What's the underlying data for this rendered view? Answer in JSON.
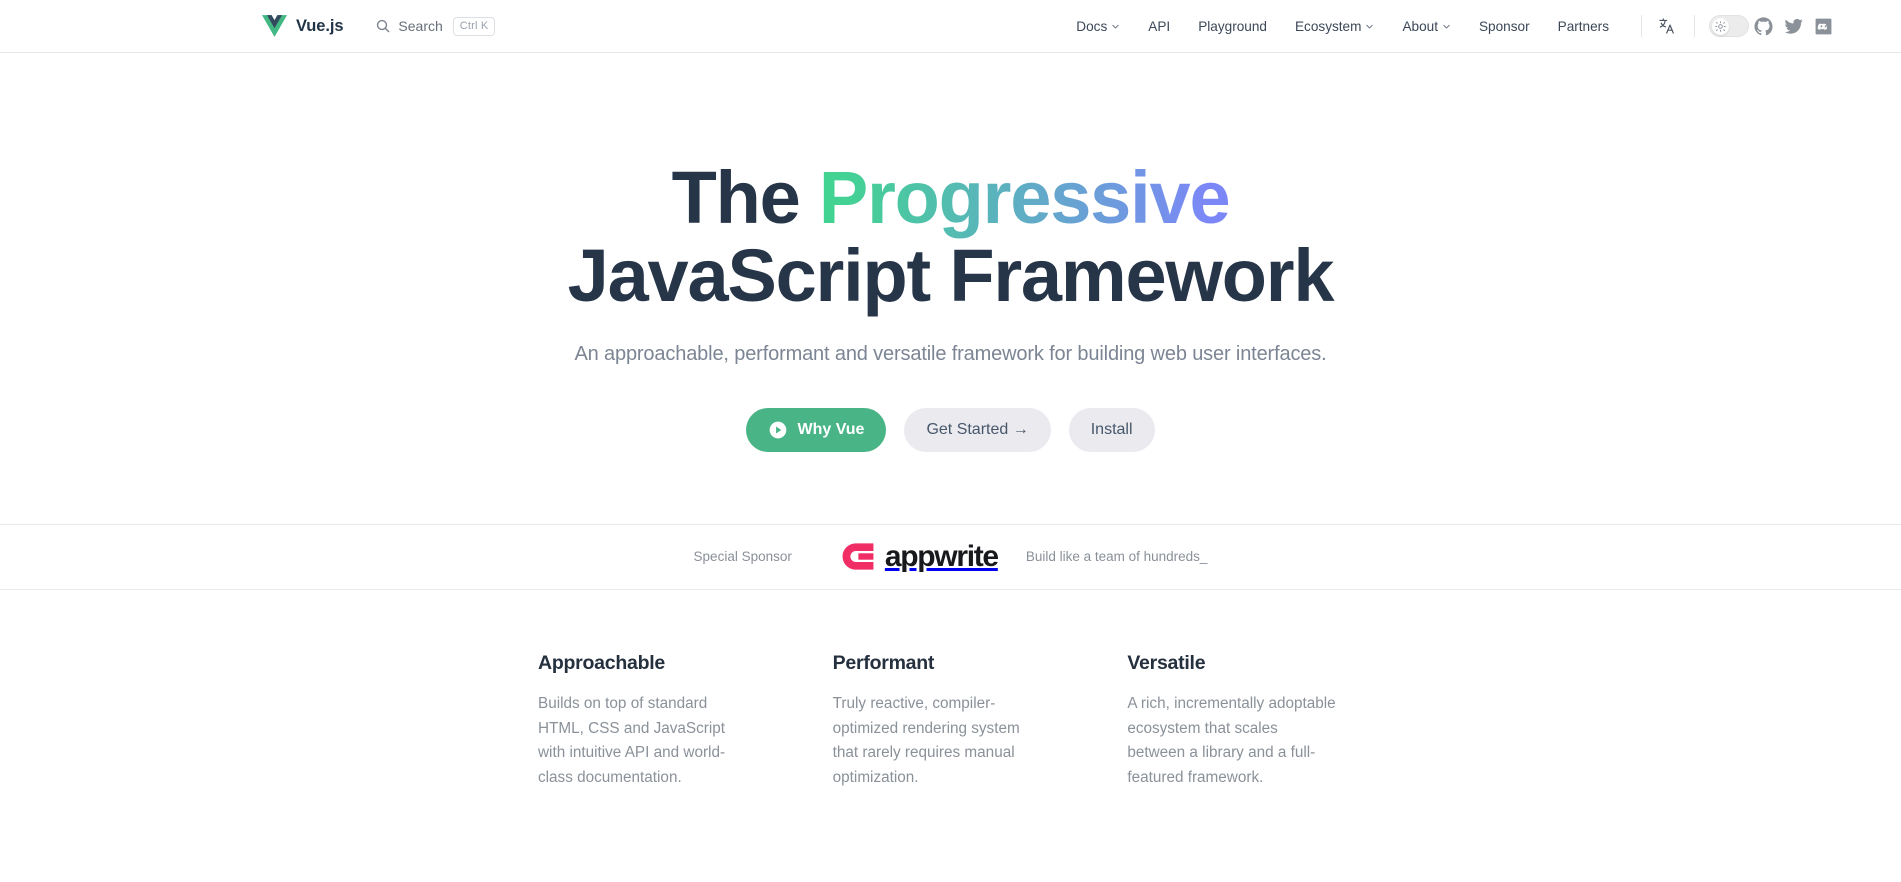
{
  "brand": {
    "name": "Vue.js",
    "logo_icon": "vue-logo-icon",
    "logo_colors": {
      "outer": "#42b883",
      "inner": "#35495e"
    }
  },
  "search": {
    "icon": "search-icon",
    "label": "Search",
    "shortcut": "Ctrl K",
    "placeholder": "Search"
  },
  "nav": {
    "links": [
      {
        "label": "Docs",
        "has_caret": true
      },
      {
        "label": "API",
        "has_caret": false
      },
      {
        "label": "Playground",
        "has_caret": false
      },
      {
        "label": "Ecosystem",
        "has_caret": true
      },
      {
        "label": "About",
        "has_caret": true
      },
      {
        "label": "Sponsor",
        "has_caret": false
      },
      {
        "label": "Partners",
        "has_caret": false
      }
    ],
    "translate_icon": "translate-icon",
    "theme_toggle": {
      "icon": "sun-icon",
      "state": "light"
    },
    "social": [
      {
        "name": "github-icon"
      },
      {
        "name": "twitter-icon"
      },
      {
        "name": "discord-icon"
      }
    ]
  },
  "hero": {
    "title_line1_plain": "The ",
    "title_line1_gradient": "Progressive",
    "title_line2": "JavaScript Framework",
    "tagline": "An approachable, performant and versatile framework for building web user interfaces.",
    "gradient_from": "#42d392",
    "gradient_to": "#7c87f7",
    "title_color": "#273549",
    "actions": [
      {
        "label": "Why Vue",
        "style": "brand",
        "icon": "play-circle-icon"
      },
      {
        "label": "Get Started →",
        "style": "alt",
        "icon": ""
      },
      {
        "label": "Install",
        "style": "alt",
        "icon": ""
      }
    ]
  },
  "sponsor": {
    "label": "Special Sponsor",
    "logo_icon": "appwrite-logo-icon",
    "logo_text": "appwrite",
    "logo_color": "#f02e65",
    "tagline": "Build like a team of hundreds_"
  },
  "features": [
    {
      "title": "Approachable",
      "description": "Builds on top of standard HTML, CSS and JavaScript with intuitive API and world-class documentation."
    },
    {
      "title": "Performant",
      "description": "Truly reactive, compiler-optimized rendering system that rarely requires manual optimization."
    },
    {
      "title": "Versatile",
      "description": "A rich, incrementally adoptable ecosystem that scales between a library and a full-featured framework."
    }
  ]
}
